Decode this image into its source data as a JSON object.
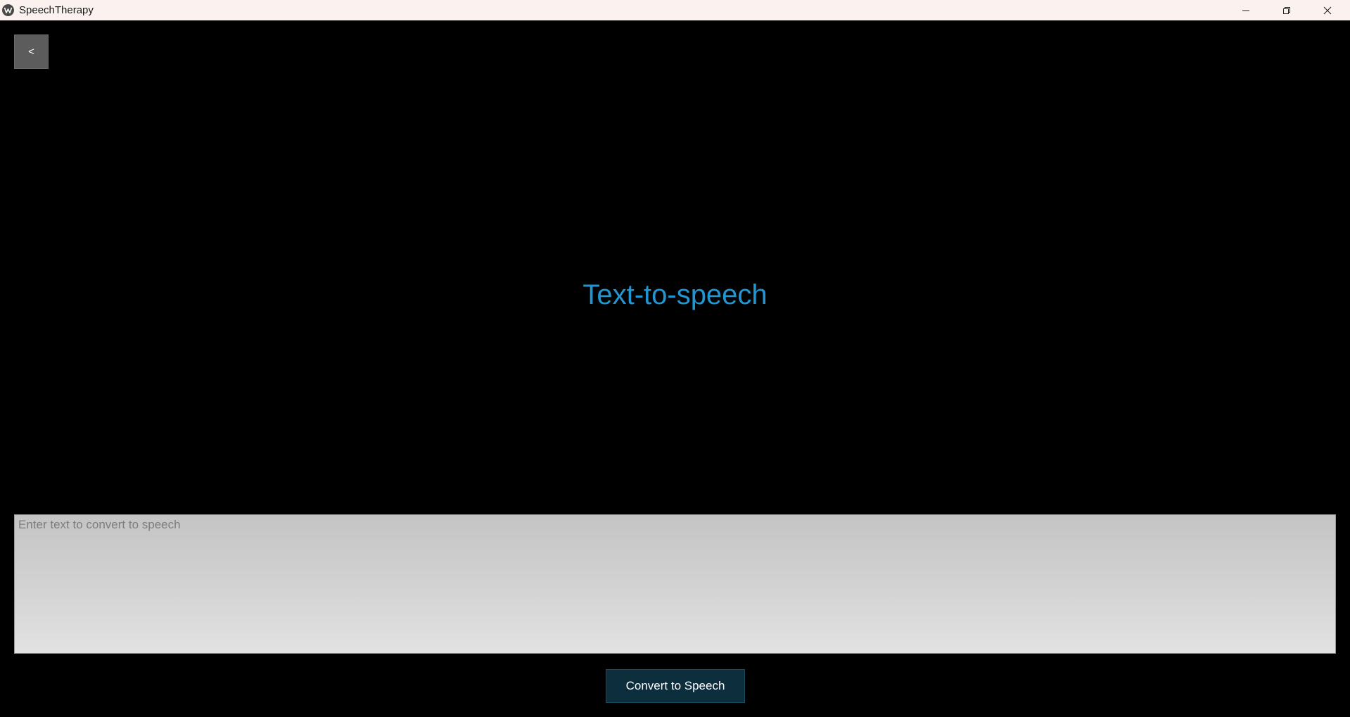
{
  "window": {
    "title": "SpeechTherapy",
    "controls": [
      "minimize-icon",
      "restore-icon",
      "close-icon"
    ]
  },
  "nav": {
    "back_label": "<"
  },
  "main": {
    "title": "Text-to-speech",
    "input_placeholder": "Enter text to convert to speech",
    "input_value": "",
    "convert_label": "Convert to Speech"
  },
  "colors": {
    "titlebar": "#fbf1ef",
    "background": "#000000",
    "title_accent": "#2196d3",
    "back_button": "#5c5c5c",
    "convert_button": "#0d2e3d"
  }
}
